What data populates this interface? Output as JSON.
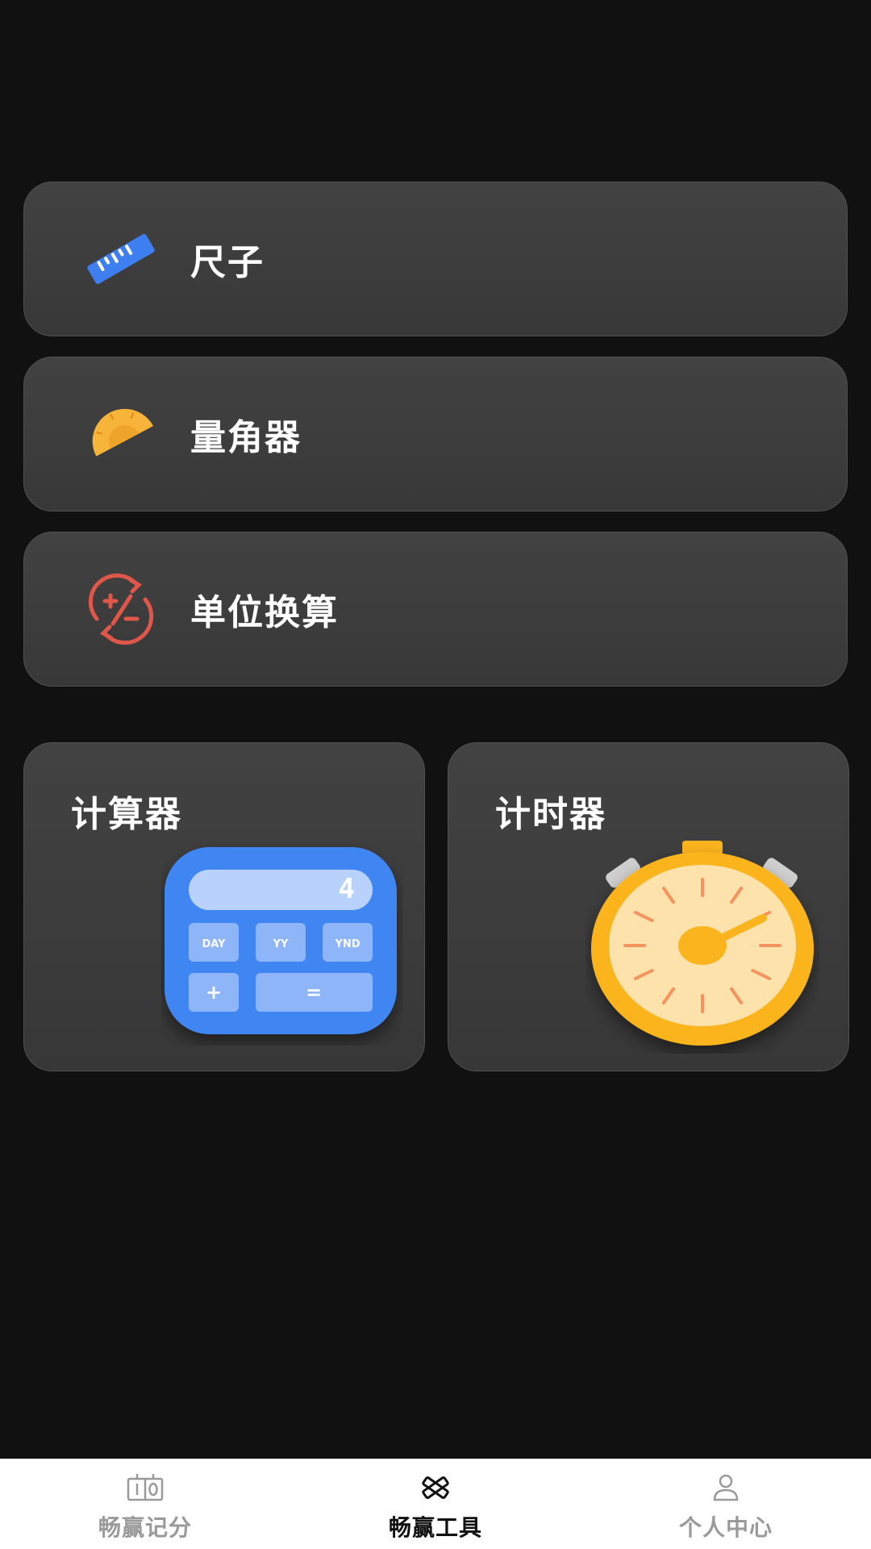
{
  "tools": [
    {
      "label": "尺子",
      "icon": "ruler-icon",
      "color": "#3d7ef0"
    },
    {
      "label": "量角器",
      "icon": "protractor-icon",
      "color": "#f7b43a"
    },
    {
      "label": "单位换算",
      "icon": "unit-conversion-icon",
      "color": "#e0574a"
    }
  ],
  "cards": {
    "calculator": {
      "label": "计算器",
      "icon": "calculator-icon",
      "display": "4",
      "keys": [
        "DAY",
        "YY",
        "YND",
        "+",
        "="
      ]
    },
    "timer": {
      "label": "计时器",
      "icon": "stopwatch-icon"
    }
  },
  "nav": {
    "items": [
      {
        "label": "畅赢记分",
        "icon": "scoreboard-icon",
        "active": false
      },
      {
        "label": "畅赢工具",
        "icon": "tools-icon",
        "active": true
      },
      {
        "label": "个人中心",
        "icon": "person-icon",
        "active": false
      }
    ]
  },
  "colors": {
    "background": "#121111",
    "card": "#3c3c3c",
    "nav_background": "#ffffff",
    "accent_blue": "#3d7ef0",
    "accent_yellow": "#fbb41d",
    "accent_red": "#e0574a"
  }
}
